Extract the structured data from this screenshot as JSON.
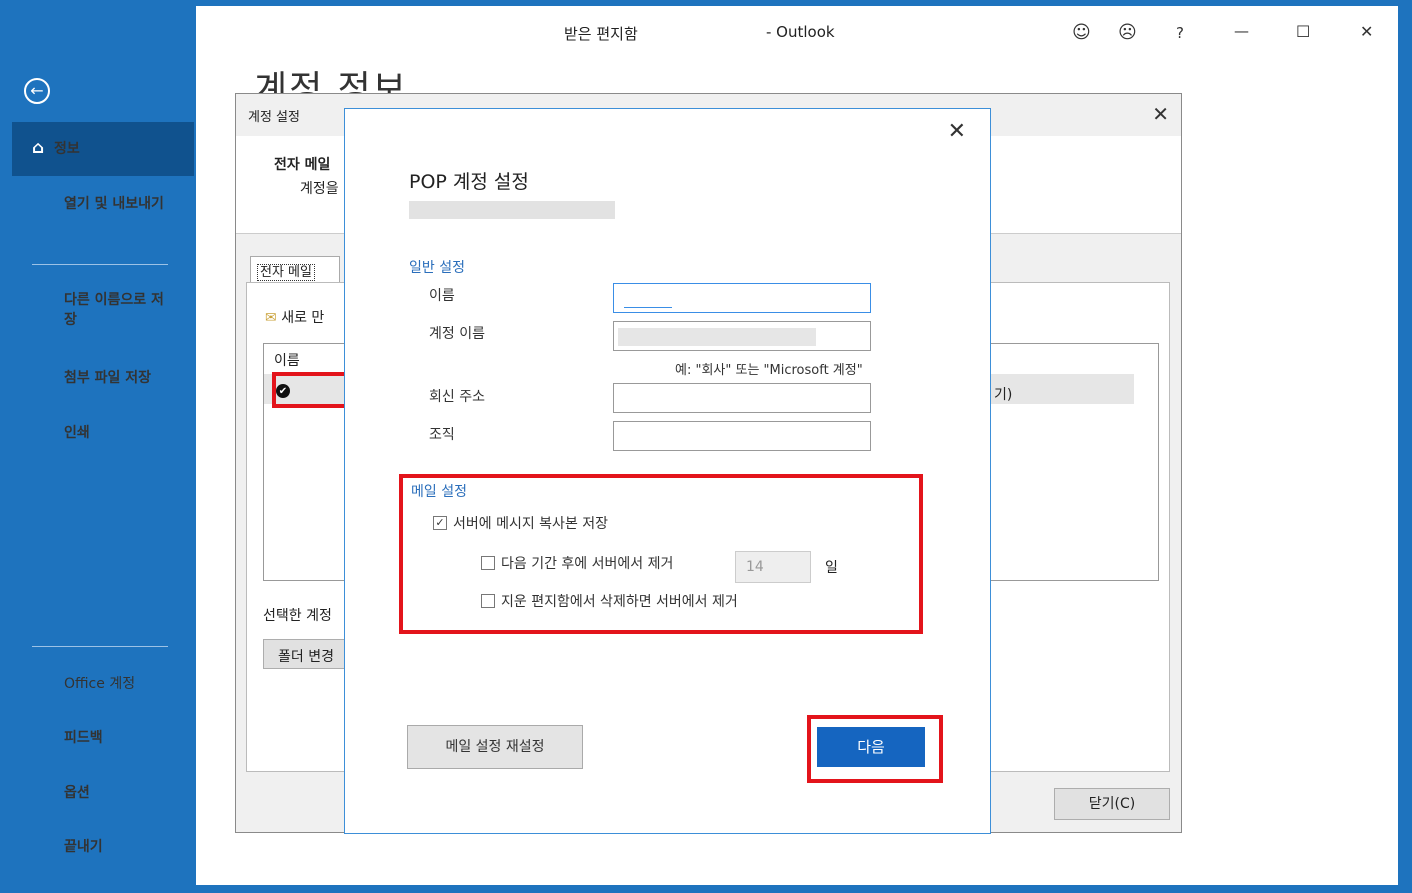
{
  "window": {
    "title_left": "받은 편지함",
    "title_right": "- Outlook",
    "icons": {
      "smile": "smile-icon",
      "frown": "frown-icon",
      "help": "?",
      "minimize": "—",
      "maximize": "☐",
      "close": "✕"
    }
  },
  "sidebar": {
    "back_icon": "←",
    "items": [
      {
        "label": "정보",
        "icon": "⌂"
      },
      {
        "label": "열기 및 내보내기"
      },
      {
        "label": "다른 이름으로 저장"
      },
      {
        "label": "첨부 파일 저장"
      },
      {
        "label": "인쇄"
      },
      {
        "label": "Office 계정"
      },
      {
        "label": "피드백"
      },
      {
        "label": "옵션"
      },
      {
        "label": "끝내기"
      }
    ]
  },
  "backstage": {
    "page_title": "계정 정보"
  },
  "account_settings": {
    "title": "계정 설정",
    "close": "✕",
    "header_title": "전자 메일",
    "header_sub": "계정을",
    "tab": "전자 메일",
    "new_label": "새로 만",
    "list_header": "이름",
    "row_suffix": "기)",
    "selected_label": "선택한 계정",
    "folder_button": "폴더 변경",
    "close_button": "닫기(C)"
  },
  "pop_dialog": {
    "close": "✕",
    "title": "POP 계정 설정",
    "general_section": "일반 설정",
    "name_label": "이름",
    "account_name_label": "계정 이름",
    "example": "예: \"회사\" 또는 \"Microsoft 계정\"",
    "reply_label": "회신 주소",
    "org_label": "조직",
    "mail_section": "메일 설정",
    "keep_copy": "서버에 메시지 복사본 저장",
    "keep_copy_checked": true,
    "remove_after": "다음 기간 후에 서버에서 제거",
    "remove_after_checked": false,
    "days_value": "14",
    "days_unit": "일",
    "remove_deleted": "지운 편지함에서 삭제하면 서버에서 제거",
    "remove_deleted_checked": false,
    "reset_button": "메일 설정 재설정",
    "next_button": "다음"
  },
  "colors": {
    "accent": "#1e73be",
    "active": "#10528e",
    "highlight_red": "#e3141b",
    "primary_button": "#1565c0"
  }
}
